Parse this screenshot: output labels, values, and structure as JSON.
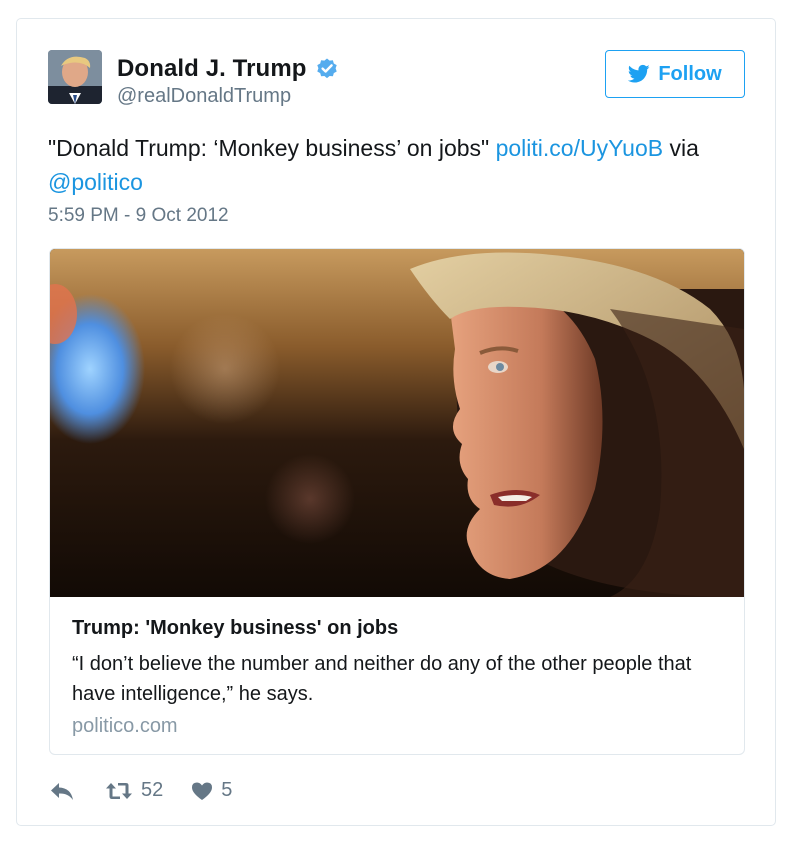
{
  "user": {
    "display_name": "Donald J. Trump",
    "handle": "@realDonaldTrump",
    "verified_icon": "verified-badge-icon"
  },
  "follow_button": {
    "label": "Follow",
    "icon": "twitter-bird-icon"
  },
  "tweet": {
    "text_prefix": "\"Donald Trump: ‘Monkey business’ on jobs\" ",
    "link_text": "politi.co/UyYuoB",
    "text_via": " via ",
    "mention": "@politico",
    "timestamp": "5:59 PM - 9 Oct 2012"
  },
  "card": {
    "title": "Trump: 'Monkey business' on jobs",
    "description": "“I don’t believe the number and neither do any of the other people that have intelligence,” he says.",
    "domain": "politico.com"
  },
  "actions": {
    "reply_icon": "reply-icon",
    "retweet_icon": "retweet-icon",
    "retweet_count": "52",
    "like_icon": "heart-icon",
    "like_count": "5"
  },
  "colors": {
    "link": "#1b95e0",
    "follow_accent": "#1da1f2",
    "secondary_text": "#657786",
    "border": "#e1e8ed"
  }
}
